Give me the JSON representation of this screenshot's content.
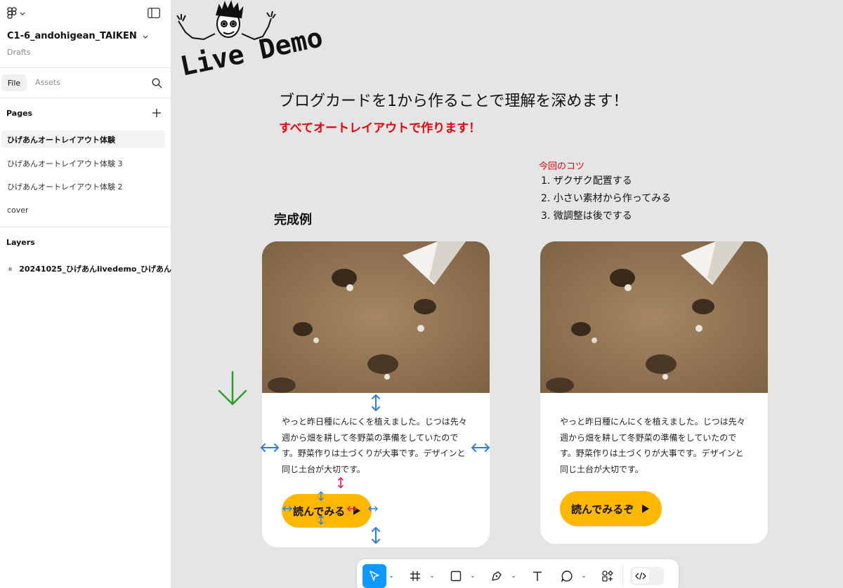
{
  "file": {
    "name": "C1-6_andohigean_TAIKEN",
    "location": "Drafts"
  },
  "tabs": {
    "file": "File",
    "assets": "Assets"
  },
  "pages": {
    "title": "Pages",
    "items": [
      {
        "label": "ひげあんオートレイアウト体験"
      },
      {
        "label": "ひげあんオートレイアウト体験 3"
      },
      {
        "label": "ひげあんオートレイアウト体験 2"
      },
      {
        "label": "cover"
      }
    ]
  },
  "layers": {
    "title": "Layers",
    "items": [
      {
        "label": "20241025_ひげあんlivedemo_ひげあん"
      }
    ]
  },
  "canvas": {
    "logo_text": "Live Demo",
    "headline": "ブログカードを1から作ることで理解を深めます！",
    "subhead": "すべてオートレイアウトで作ります！",
    "tips_title": "今回のコツ",
    "tips": [
      "1. ザクザク配置する",
      "2. 小さい素材から作ってみる",
      "3. 微調整は後でする"
    ],
    "example_label": "完成例",
    "card1": {
      "text": "やっと昨日種にんにくを植えました。じつは先々週から畑を耕して冬野菜の準備をしていたのです。野菜作りは土づくりが大事です。デザインと同じ土台が大切です。",
      "button_label": "読んでみる"
    },
    "card2": {
      "text": "やっと昨日種にんにくを植えました。じつは先々週から畑を耕して冬野菜の準備をしていたのです。野菜作りは土づくりが大事です。デザインと同じ土台が大切です。",
      "button_label": "読んでみるぞ"
    }
  },
  "toolbar": {
    "tools": [
      "move-tool",
      "frame-tool",
      "shape-tool",
      "pen-tool",
      "text-tool",
      "comment-tool",
      "actions-tool"
    ],
    "active": "move-tool"
  },
  "colors": {
    "accent": "#0d99ff",
    "highlight_red": "#e8000b",
    "button_yellow": "#ffb700",
    "annotation_blue": "#2b7de9",
    "annotation_pink": "#e8206b",
    "arrow_green": "#2aa02a"
  }
}
